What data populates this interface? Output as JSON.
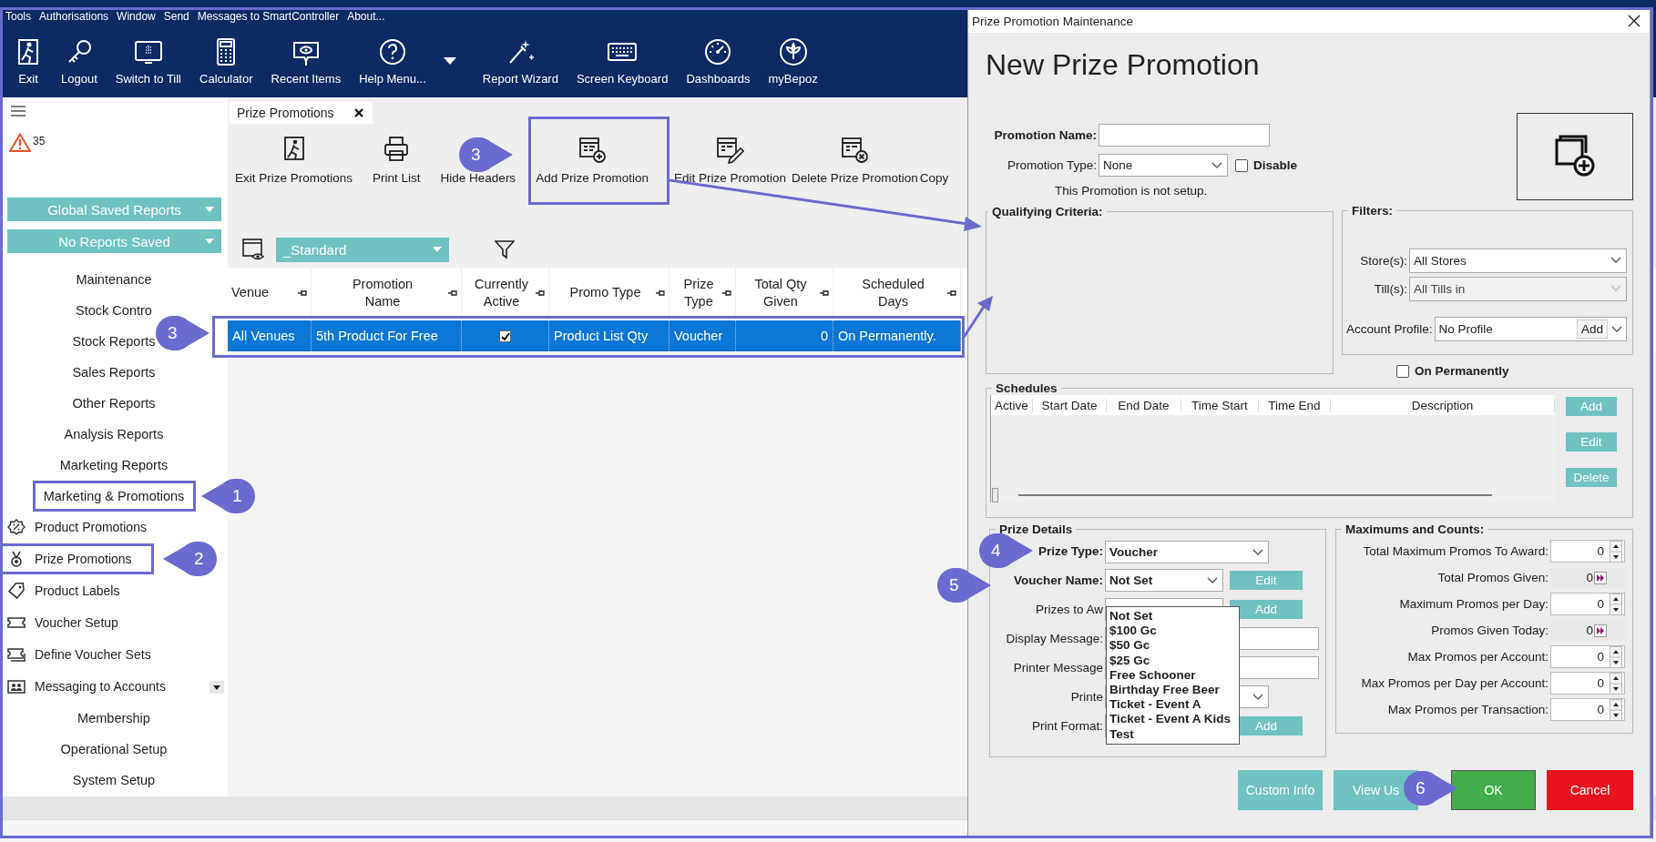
{
  "menu_bar": [
    "Tools",
    "Authorisations",
    "Window",
    "Send",
    "Messages to SmartController",
    "About..."
  ],
  "toolbar": [
    {
      "label": "Exit",
      "dropdown": false
    },
    {
      "label": "Logout",
      "dropdown": false
    },
    {
      "label": "Switch to Till",
      "dropdown": false
    },
    {
      "label": "Calculator",
      "dropdown": false
    },
    {
      "label": "Recent Items",
      "dropdown": false
    },
    {
      "label": "Help Menu...",
      "dropdown": true
    },
    {
      "label": "Report Wizard",
      "dropdown": false
    },
    {
      "label": "Screen Keyboard",
      "dropdown": false
    },
    {
      "label": "Dashboards",
      "dropdown": false
    },
    {
      "label": "myBepoz",
      "dropdown": false
    }
  ],
  "sidebar": {
    "alert_count": "35",
    "report_buttons": [
      "Global Saved Reports",
      "No Reports Saved"
    ],
    "items": [
      {
        "label": "Maintenance",
        "kind": "section"
      },
      {
        "label": "Stock Contro",
        "kind": "section"
      },
      {
        "label": "Stock Reports",
        "kind": "section"
      },
      {
        "label": "Sales Reports",
        "kind": "section"
      },
      {
        "label": "Other Reports",
        "kind": "section"
      },
      {
        "label": "Analysis Reports",
        "kind": "section"
      },
      {
        "label": "Marketing Reports",
        "kind": "section"
      },
      {
        "label": "Marketing & Promotions",
        "kind": "section"
      },
      {
        "label": "Product Promotions",
        "kind": "link"
      },
      {
        "label": "Prize Promotions",
        "kind": "link"
      },
      {
        "label": "Product Labels",
        "kind": "link"
      },
      {
        "label": "Voucher Setup",
        "kind": "link"
      },
      {
        "label": "Define Voucher Sets",
        "kind": "link"
      },
      {
        "label": "Messaging to Accounts",
        "kind": "link"
      },
      {
        "label": "Membership",
        "kind": "section"
      },
      {
        "label": "Operational Setup",
        "kind": "section"
      },
      {
        "label": "System Setup",
        "kind": "section"
      }
    ]
  },
  "document_tab": {
    "label": "Prize Promotions"
  },
  "actions": [
    "Exit Prize Promotions",
    "Print List",
    "Hide Headers",
    "Add Prize Promotion",
    "Edit Prize Promotion",
    "Delete Prize Promotion",
    "Copy"
  ],
  "layout_select": {
    "value": "_Standard"
  },
  "grid": {
    "columns": [
      "Venue",
      "Promotion Name",
      "Currently Active",
      "Promo Type",
      "Prize Type",
      "Total Qty Given",
      "Scheduled Days"
    ],
    "rows": [
      {
        "selected": true,
        "venue": "All Venues",
        "promotion_name": "5th Product For Free",
        "currently_active": true,
        "promo_type": "Product List Qty",
        "prize_type": "Voucher",
        "total_qty_given": "0",
        "scheduled_days": "On Permanently."
      }
    ]
  },
  "dialog": {
    "title": "Prize Promotion Maintenance",
    "heading": "New Prize Promotion",
    "promotion_name": {
      "label": "Promotion Name:"
    },
    "promotion_type": {
      "label": "Promotion Type:",
      "value": "None"
    },
    "disable": {
      "label": "Disable",
      "checked": false
    },
    "setup_note": "This Promotion is not setup.",
    "qualifying_criteria": {
      "title": "Qualifying Criteria:"
    },
    "filters": {
      "title": "Filters:",
      "stores": {
        "label": "Store(s):",
        "value": "All Stores",
        "disabled": false
      },
      "tills": {
        "label": "Till(s):",
        "value": "All Tills in",
        "disabled": true
      },
      "account_profile": {
        "label": "Account Profile:",
        "value": "No Profile",
        "button": "Add"
      }
    },
    "on_permanently": {
      "label": "On Permanently",
      "checked": false
    },
    "schedules": {
      "title": "Schedules",
      "columns": [
        "Active",
        "Start Date",
        "End Date",
        "Time Start",
        "Time End",
        "Description"
      ],
      "buttons": [
        "Add",
        "Edit",
        "Delete"
      ]
    },
    "prize_details": {
      "title": "Prize Details",
      "fields": [
        {
          "kind": "select",
          "label": "Prize Type:",
          "bold": true,
          "value": "Voucher"
        },
        {
          "kind": "select",
          "label": "Voucher Name:",
          "bold": true,
          "value": "Not Set",
          "button": "Edit"
        },
        {
          "kind": "text",
          "label": "Prizes to Aw",
          "bold": false,
          "button": "Add"
        },
        {
          "kind": "text",
          "label": "Display Message:",
          "bold": false
        },
        {
          "kind": "text",
          "label": "Printer Message",
          "bold": false
        },
        {
          "kind": "select",
          "label": "Printe",
          "bold": false
        },
        {
          "kind": "text",
          "label": "Print Format:",
          "bold": false,
          "button": "Add"
        }
      ],
      "dropdown_options": [
        "Not Set",
        "$100 Gc",
        "$50 Gc",
        "$25 Gc",
        "Free Schooner",
        "Birthday Free Beer",
        "Ticket - Event A",
        "Ticket - Event A Kids",
        "Test"
      ]
    },
    "maximums": {
      "title": "Maximums and Counts:",
      "rows": [
        {
          "kind": "spin",
          "label": "Total Maximum Promos To Award:",
          "value": "0"
        },
        {
          "kind": "readout",
          "label": "Total Promos Given:",
          "value": "0"
        },
        {
          "kind": "spin",
          "label": "Maximum Promos per Day:",
          "value": "0"
        },
        {
          "kind": "readout",
          "label": "Promos Given Today:",
          "value": "0"
        },
        {
          "kind": "spin",
          "label": "Max Promos per Account:",
          "value": "0"
        },
        {
          "kind": "spin",
          "label": "Max Promos per Day per Account:",
          "value": "0"
        },
        {
          "kind": "spin",
          "label": "Max Promos per Transaction:",
          "value": "0"
        }
      ]
    },
    "buttons": [
      {
        "label": "Custom Info",
        "kind": "secondary"
      },
      {
        "label": "View Us",
        "kind": "secondary"
      },
      {
        "label": "OK",
        "kind": "ok"
      },
      {
        "label": "Cancel",
        "kind": "cancel"
      }
    ]
  },
  "annotations": {
    "callouts": [
      "3",
      "3",
      "1",
      "2",
      "4",
      "5",
      "6"
    ]
  }
}
